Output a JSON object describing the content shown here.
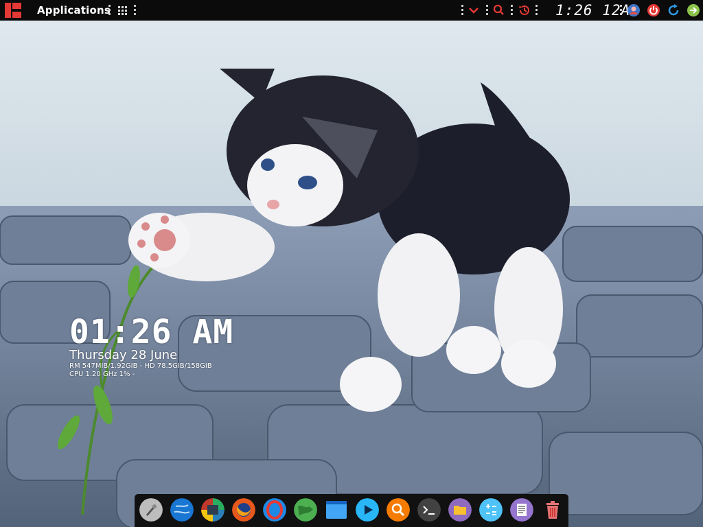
{
  "top_panel": {
    "menu_label": "Applications",
    "clock": "1:26 12A",
    "indicators": [
      "chevron-down-icon",
      "search-icon",
      "history-icon"
    ],
    "system": [
      "avatar",
      "power-icon",
      "refresh-icon",
      "logout-icon"
    ]
  },
  "conky": {
    "time": "01:26 AM",
    "date": "Thursday 28 June",
    "ram_disk": "RM 547MIB/1.92GIB - HD 78.5GIB/158GIB",
    "cpu": "CPU 1.20 GHz 1% -"
  },
  "dock": {
    "items": [
      "launcher",
      "browser-globe",
      "photos",
      "firefox",
      "opera",
      "world-map",
      "window-manager",
      "media-player",
      "app-search",
      "terminal",
      "files",
      "calculator",
      "text-editor",
      "trash"
    ]
  },
  "colors": {
    "panel": "#0b0b0b",
    "accent_red": "#e53935",
    "dock": "#111111"
  }
}
